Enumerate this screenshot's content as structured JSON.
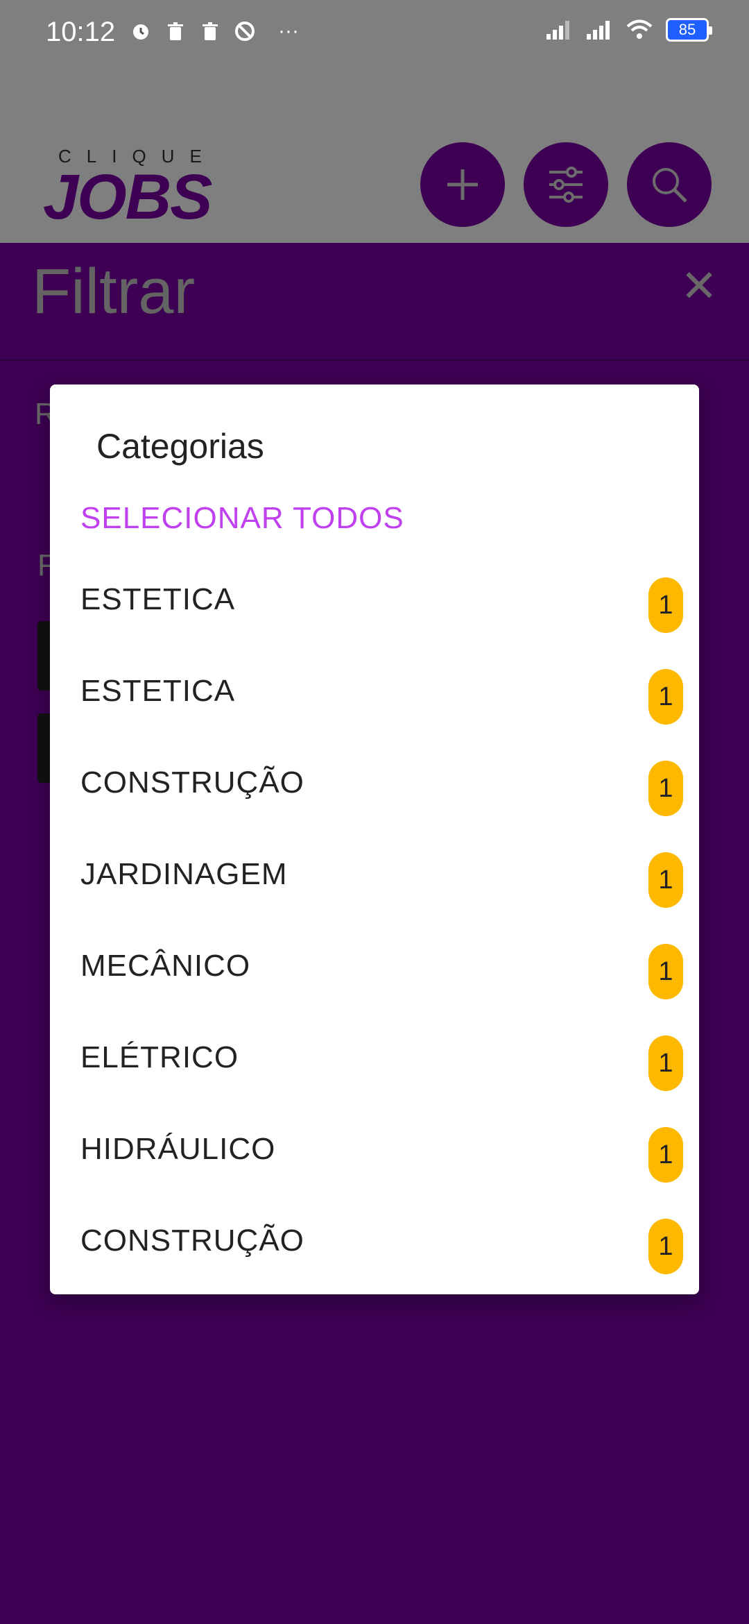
{
  "status_bar": {
    "time": "10:12",
    "battery": "85",
    "more": "···"
  },
  "app": {
    "logo_top": "CLIQUE",
    "logo_main": "JOBS"
  },
  "filter_panel": {
    "title": "Filtrar",
    "close": "✕",
    "stub_1": "R",
    "stub_2": "F"
  },
  "dialog": {
    "title": "Categorias",
    "select_all": "SELECIONAR TODOS",
    "items": [
      {
        "label": "ESTETICA",
        "count": "1"
      },
      {
        "label": "ESTETICA",
        "count": "1"
      },
      {
        "label": "CONSTRUÇÃO",
        "count": "1"
      },
      {
        "label": "JARDINAGEM",
        "count": "1"
      },
      {
        "label": "MECÂNICO",
        "count": "1"
      },
      {
        "label": "ELÉTRICO",
        "count": "1"
      },
      {
        "label": "HIDRÁULICO",
        "count": "1"
      },
      {
        "label": "CONSTRUÇÃO",
        "count": "1"
      }
    ]
  },
  "colors": {
    "brand": "#7a00a6",
    "accent": "#c040f0",
    "badge": "#ffb800"
  }
}
